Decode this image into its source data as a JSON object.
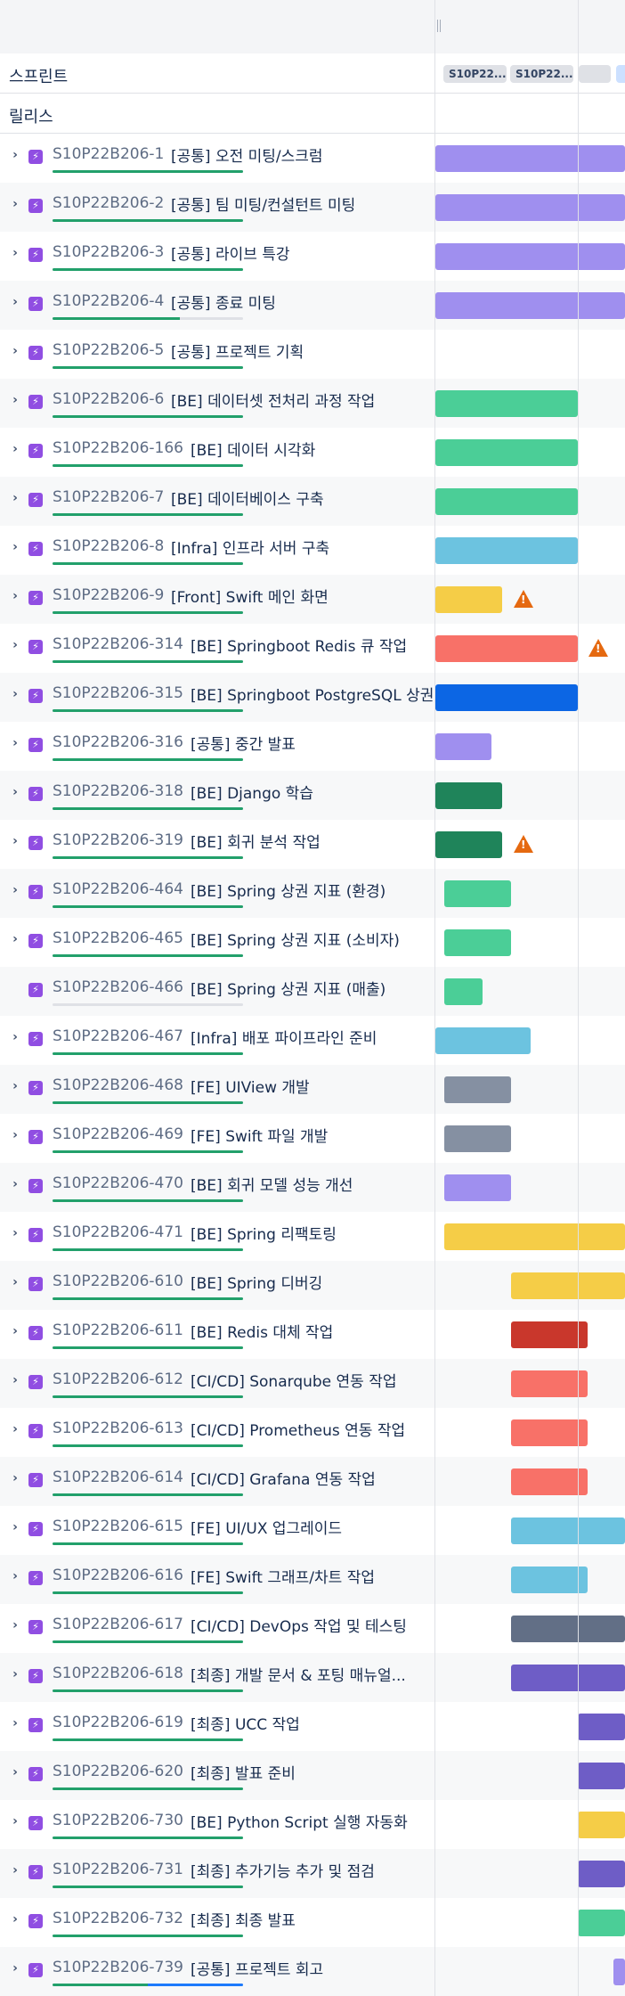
{
  "meta": {
    "sprint_label": "스프린트",
    "release_label": "릴리스"
  },
  "sprints": [
    {
      "label": "S10P22..."
    },
    {
      "label": "S10P22..."
    }
  ],
  "epics": [
    {
      "key": "S10P22B206-1",
      "title": "[공통] 오전 미팅/스크럼",
      "expandable": true,
      "done": 1.0,
      "inprogress": 0,
      "bar": {
        "color": "#9f8fef"
      },
      "warning": false
    },
    {
      "key": "S10P22B206-2",
      "title": "[공통] 팀 미팅/컨설턴트 미팅",
      "expandable": true,
      "done": 1.0,
      "inprogress": 0,
      "bar": {
        "color": "#9f8fef"
      },
      "warning": false
    },
    {
      "key": "S10P22B206-3",
      "title": "[공통] 라이브 특강",
      "expandable": true,
      "done": 1.0,
      "inprogress": 0,
      "bar": {
        "color": "#9f8fef"
      },
      "warning": false
    },
    {
      "key": "S10P22B206-4",
      "title": "[공통] 종료 미팅",
      "expandable": true,
      "done": 0.67,
      "inprogress": 0,
      "bar": {
        "color": "#9f8fef"
      },
      "warning": false
    },
    {
      "key": "S10P22B206-5",
      "title": "[공통] 프로젝트 기획",
      "expandable": true,
      "done": 1.0,
      "inprogress": 0,
      "bar": null,
      "warning": false
    },
    {
      "key": "S10P22B206-6",
      "title": "[BE] 데이터셋 전처리 과정 작업",
      "expandable": true,
      "done": 1.0,
      "inprogress": 0,
      "bar": {
        "color": "#4bce97"
      },
      "warning": false
    },
    {
      "key": "S10P22B206-166",
      "title": "[BE] 데이터 시각화",
      "expandable": true,
      "done": 1.0,
      "inprogress": 0,
      "bar": {
        "color": "#4bce97"
      },
      "warning": false
    },
    {
      "key": "S10P22B206-7",
      "title": "[BE] 데이터베이스 구축",
      "expandable": true,
      "done": 1.0,
      "inprogress": 0,
      "bar": {
        "color": "#4bce97"
      },
      "warning": false
    },
    {
      "key": "S10P22B206-8",
      "title": "[Infra] 인프라 서버 구축",
      "expandable": true,
      "done": 1.0,
      "inprogress": 0,
      "bar": {
        "color": "#6cc3e0"
      },
      "warning": false
    },
    {
      "key": "S10P22B206-9",
      "title": "[Front] Swift 메인 화면",
      "expandable": true,
      "done": 1.0,
      "inprogress": 0,
      "bar": {
        "color": "#f5cd47"
      },
      "warning": true
    },
    {
      "key": "S10P22B206-314",
      "title": "[BE] Springboot Redis 큐 작업",
      "expandable": true,
      "done": 1.0,
      "inprogress": 0,
      "bar": {
        "color": "#f87168"
      },
      "warning": true
    },
    {
      "key": "S10P22B206-315",
      "title": "[BE] Springboot PostgreSQL 상권...",
      "expandable": true,
      "done": 1.0,
      "inprogress": 0,
      "bar": {
        "color": "#0c66e4"
      },
      "warning": false
    },
    {
      "key": "S10P22B206-316",
      "title": "[공통] 중간 발표",
      "expandable": true,
      "done": 1.0,
      "inprogress": 0,
      "bar": {
        "color": "#9f8fef"
      },
      "warning": false
    },
    {
      "key": "S10P22B206-318",
      "title": "[BE] Django 학습",
      "expandable": true,
      "done": 1.0,
      "inprogress": 0,
      "bar": {
        "color": "#1f845a"
      },
      "warning": false
    },
    {
      "key": "S10P22B206-319",
      "title": "[BE] 회귀 분석 작업",
      "expandable": true,
      "done": 1.0,
      "inprogress": 0,
      "bar": {
        "color": "#1f845a"
      },
      "warning": true
    },
    {
      "key": "S10P22B206-464",
      "title": "[BE] Spring 상권 지표 (환경)",
      "expandable": true,
      "done": 1.0,
      "inprogress": 0,
      "bar": {
        "color": "#4bce97"
      },
      "warning": false
    },
    {
      "key": "S10P22B206-465",
      "title": "[BE] Spring 상권 지표 (소비자)",
      "expandable": true,
      "done": 1.0,
      "inprogress": 0,
      "bar": {
        "color": "#4bce97"
      },
      "warning": false
    },
    {
      "key": "S10P22B206-466",
      "title": "[BE] Spring 상권 지표 (매출)",
      "expandable": false,
      "done": 0,
      "inprogress": 0,
      "bar": {
        "color": "#4bce97"
      },
      "warning": false
    },
    {
      "key": "S10P22B206-467",
      "title": "[Infra] 배포 파이프라인 준비",
      "expandable": true,
      "done": 1.0,
      "inprogress": 0,
      "bar": {
        "color": "#6cc3e0"
      },
      "warning": false
    },
    {
      "key": "S10P22B206-468",
      "title": "[FE] UIView 개발",
      "expandable": true,
      "done": 1.0,
      "inprogress": 0,
      "bar": {
        "color": "#8590a2"
      },
      "warning": false
    },
    {
      "key": "S10P22B206-469",
      "title": "[FE] Swift 파일 개발",
      "expandable": true,
      "done": 1.0,
      "inprogress": 0,
      "bar": {
        "color": "#8590a2"
      },
      "warning": false
    },
    {
      "key": "S10P22B206-470",
      "title": "[BE] 회귀 모델 성능 개선",
      "expandable": true,
      "done": 1.0,
      "inprogress": 0,
      "bar": {
        "color": "#9f8fef"
      },
      "warning": false
    },
    {
      "key": "S10P22B206-471",
      "title": "[BE] Spring 리팩토링",
      "expandable": true,
      "done": 1.0,
      "inprogress": 0,
      "bar": {
        "color": "#f5cd47"
      },
      "warning": false
    },
    {
      "key": "S10P22B206-610",
      "title": "[BE] Spring 디버깅",
      "expandable": true,
      "done": 1.0,
      "inprogress": 0,
      "bar": {
        "color": "#f5cd47"
      },
      "warning": false
    },
    {
      "key": "S10P22B206-611",
      "title": "[BE] Redis 대체 작업",
      "expandable": true,
      "done": 1.0,
      "inprogress": 0,
      "bar": {
        "color": "#c9372c"
      },
      "warning": false
    },
    {
      "key": "S10P22B206-612",
      "title": "[CI/CD] Sonarqube 연동 작업",
      "expandable": true,
      "done": 1.0,
      "inprogress": 0,
      "bar": {
        "color": "#f87168"
      },
      "warning": false
    },
    {
      "key": "S10P22B206-613",
      "title": "[CI/CD] Prometheus 연동 작업",
      "expandable": true,
      "done": 1.0,
      "inprogress": 0,
      "bar": {
        "color": "#f87168"
      },
      "warning": false
    },
    {
      "key": "S10P22B206-614",
      "title": "[CI/CD] Grafana 연동 작업",
      "expandable": true,
      "done": 1.0,
      "inprogress": 0,
      "bar": {
        "color": "#f87168"
      },
      "warning": false
    },
    {
      "key": "S10P22B206-615",
      "title": "[FE] UI/UX 업그레이드",
      "expandable": true,
      "done": 1.0,
      "inprogress": 0,
      "bar": {
        "color": "#6cc3e0"
      },
      "warning": false
    },
    {
      "key": "S10P22B206-616",
      "title": "[FE] Swift 그래프/차트 작업",
      "expandable": true,
      "done": 1.0,
      "inprogress": 0,
      "bar": {
        "color": "#6cc3e0"
      },
      "warning": false
    },
    {
      "key": "S10P22B206-617",
      "title": "[CI/CD] DevOps 작업 및 테스팅",
      "expandable": true,
      "done": 1.0,
      "inprogress": 0,
      "bar": {
        "color": "#626f86"
      },
      "warning": false
    },
    {
      "key": "S10P22B206-618",
      "title": "[최종] 개발 문서 & 포팅 매뉴얼...",
      "expandable": true,
      "done": 1.0,
      "inprogress": 0,
      "bar": {
        "color": "#6e5dc6"
      },
      "warning": false
    },
    {
      "key": "S10P22B206-619",
      "title": "[최종] UCC 작업",
      "expandable": true,
      "done": 1.0,
      "inprogress": 0,
      "bar": {
        "color": "#6e5dc6"
      },
      "warning": false
    },
    {
      "key": "S10P22B206-620",
      "title": "[최종] 발표 준비",
      "expandable": true,
      "done": 1.0,
      "inprogress": 0,
      "bar": {
        "color": "#6e5dc6"
      },
      "warning": false
    },
    {
      "key": "S10P22B206-730",
      "title": "[BE] Python Script 실행 자동화",
      "expandable": true,
      "done": 1.0,
      "inprogress": 0,
      "bar": {
        "color": "#f5cd47"
      },
      "warning": false
    },
    {
      "key": "S10P22B206-731",
      "title": "[최종] 추가기능 추가 및 점검",
      "expandable": true,
      "done": 1.0,
      "inprogress": 0,
      "bar": {
        "color": "#6e5dc6"
      },
      "warning": false
    },
    {
      "key": "S10P22B206-732",
      "title": "[최종] 최종 발표",
      "expandable": true,
      "done": 1.0,
      "inprogress": 0,
      "bar": {
        "color": "#4bce97"
      },
      "warning": false
    },
    {
      "key": "S10P22B206-739",
      "title": "[공통] 프로젝트 회고",
      "expandable": true,
      "done": 0.5,
      "inprogress": 0.5,
      "bar": {
        "color": "#9f8fef"
      },
      "warning": false
    }
  ],
  "colors": {
    "accent": "#0c66e4",
    "done": "#22a06b",
    "in_progress": "#1d7afc",
    "warning": "#e56910",
    "epic_icon": "#904ee2"
  }
}
